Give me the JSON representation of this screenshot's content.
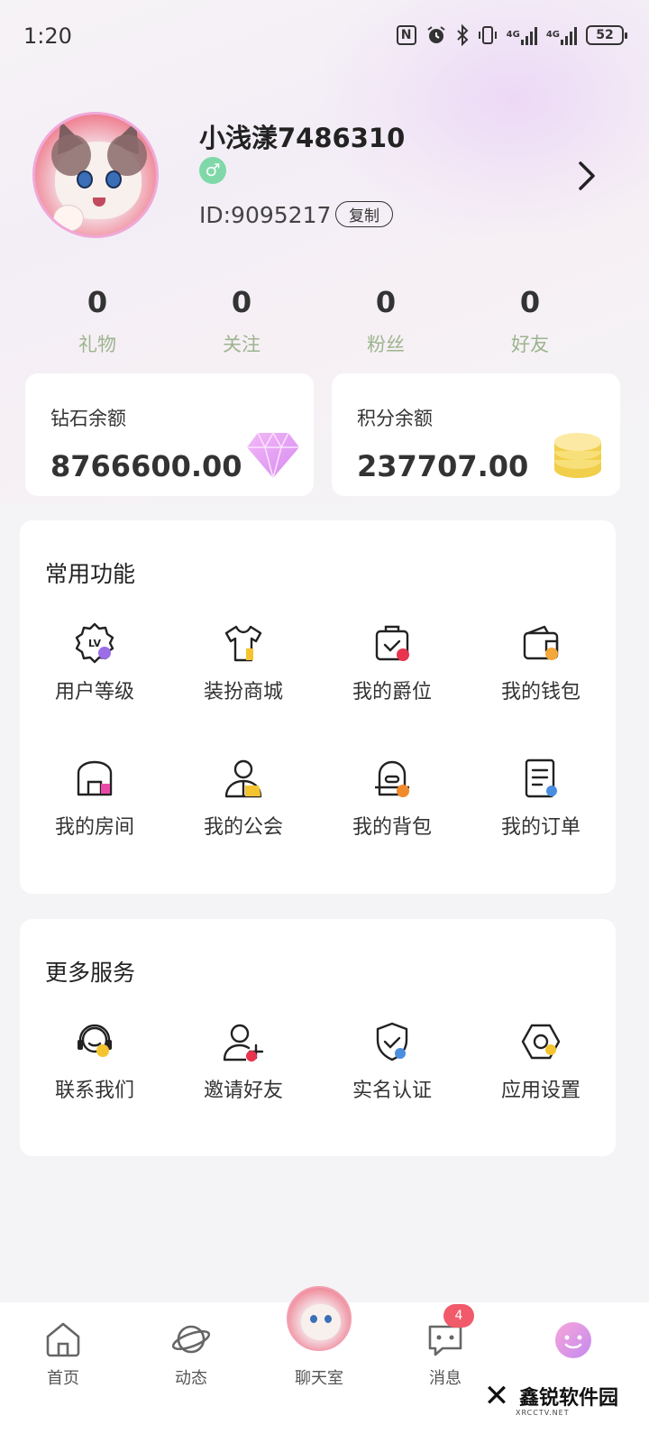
{
  "status_bar": {
    "time": "1:20",
    "network_1": "4G",
    "network_2": "4G",
    "battery": "52"
  },
  "profile": {
    "nickname": "小浅漾7486310",
    "gender_symbol": "♂",
    "id_text": "ID:9095217",
    "copy_label": "复制"
  },
  "stats": [
    {
      "value": "0",
      "label": "礼物"
    },
    {
      "value": "0",
      "label": "关注"
    },
    {
      "value": "0",
      "label": "粉丝"
    },
    {
      "value": "0",
      "label": "好友"
    }
  ],
  "balances": {
    "diamond": {
      "title": "钻石余额",
      "value": "8766600.00"
    },
    "points": {
      "title": "积分余额",
      "value": "237707.00"
    }
  },
  "common_functions": {
    "title": "常用功能",
    "items": [
      {
        "label": "用户等级",
        "icon": "level-badge-icon"
      },
      {
        "label": "装扮商城",
        "icon": "tshirt-icon"
      },
      {
        "label": "我的爵位",
        "icon": "title-bag-icon"
      },
      {
        "label": "我的钱包",
        "icon": "wallet-icon"
      },
      {
        "label": "我的房间",
        "icon": "room-icon"
      },
      {
        "label": "我的公会",
        "icon": "guild-icon"
      },
      {
        "label": "我的背包",
        "icon": "backpack-icon"
      },
      {
        "label": "我的订单",
        "icon": "order-icon"
      }
    ]
  },
  "more_services": {
    "title": "更多服务",
    "items": [
      {
        "label": "联系我们",
        "icon": "headset-icon"
      },
      {
        "label": "邀请好友",
        "icon": "invite-user-icon"
      },
      {
        "label": "实名认证",
        "icon": "shield-check-icon"
      },
      {
        "label": "应用设置",
        "icon": "settings-hex-icon"
      }
    ]
  },
  "bottom_nav": {
    "items": [
      {
        "label": "首页",
        "icon": "home-icon"
      },
      {
        "label": "动态",
        "icon": "planet-icon"
      },
      {
        "label": "聊天室",
        "icon": "chatroom-avatar"
      },
      {
        "label": "消息",
        "icon": "message-icon",
        "badge": "4"
      },
      {
        "label": "",
        "icon": "profile-face-icon"
      }
    ]
  },
  "watermark": {
    "text": "鑫锐软件园",
    "sub": "XRCCTV.NET"
  },
  "colors": {
    "stat_label": "#9db48e",
    "gender": "#7fd8a8",
    "badge": "#f05a6a",
    "accent_purple": "#9b6ee8",
    "accent_yellow": "#f4c430",
    "accent_red": "#e8344f",
    "accent_blue": "#4a8ee0"
  }
}
